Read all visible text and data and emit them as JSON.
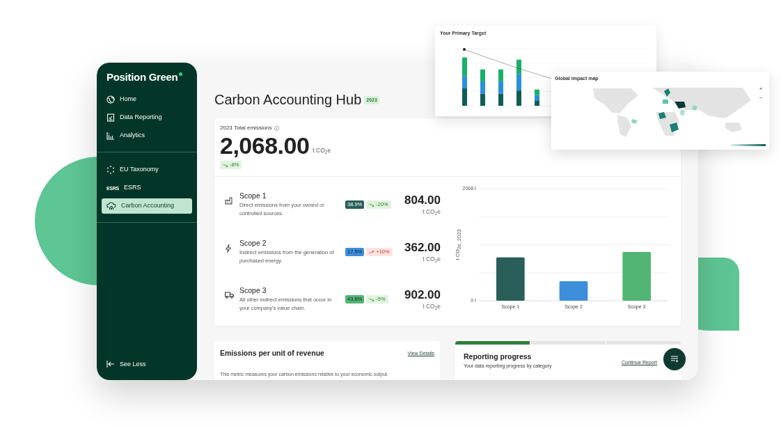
{
  "sidebar": {
    "logo": "Position Green",
    "groups": [
      {
        "items": [
          {
            "label": "Home",
            "kind": "icon",
            "selected": false
          },
          {
            "label": "Data Reporting",
            "kind": "icon",
            "selected": false
          },
          {
            "label": "Analytics",
            "kind": "icon",
            "selected": false
          }
        ]
      },
      {
        "items": [
          {
            "label": "EU Taxonomy",
            "kind": "icon",
            "selected": false
          },
          {
            "label": "ESRS",
            "kind": "text-icon",
            "icon_text": "ESRS",
            "selected": false
          },
          {
            "label": "Carbon Accounting",
            "kind": "icon",
            "selected": true
          }
        ]
      }
    ],
    "footer_link": "See Less"
  },
  "header": {
    "title": "Carbon Accounting Hub",
    "year_badge": "2023"
  },
  "total": {
    "label": "2023 Total emissions",
    "value": "2,068.00",
    "unit": "t CO$_{2}$e",
    "change": {
      "text": "-8%",
      "rising": false
    }
  },
  "scopes": [
    {
      "name": "Scope 1",
      "description": "Direct emissions from your owned or controlled sources.",
      "share": "38.9%",
      "color": "#2a5e58",
      "change": {
        "text": "-20%",
        "rising": false
      },
      "value": "804.00",
      "unit": "t CO$_{2}$e"
    },
    {
      "name": "Scope 2",
      "description": "Indirect emissions from the generation of purchased energy.",
      "share": "17.5%",
      "color": "#3d8fdc",
      "change": {
        "text": "+10%",
        "rising": true
      },
      "value": "362.00",
      "unit": "t CO$_{2}$e"
    },
    {
      "name": "Scope 3",
      "description": "All other indirect emissions that occur in your company's value chain.",
      "share": "43.6%",
      "color": "#52b574",
      "change": {
        "text": "-5%",
        "rising": false
      },
      "value": "902.00",
      "unit": "t CO$_{2}$e"
    }
  ],
  "chart_data": {
    "type": "bar",
    "ylabel": "t CO$_{2}$e, 2023",
    "categories": [
      "Scope 1",
      "Scope 2",
      "Scope 3"
    ],
    "series": [
      {
        "values": [
          800,
          360,
          900
        ]
      }
    ],
    "ylim": [
      0,
      2068
    ],
    "yticks": [
      {
        "value": 0,
        "label": "0 t"
      },
      {
        "value": 2068,
        "label": "2068 t"
      }
    ]
  },
  "cards": [
    {
      "title": "Emissions per unit of revenue",
      "link": "View Details",
      "description": "This metric measures your carbon emissions relative to your economic output."
    },
    {
      "title": "Reporting progress",
      "subtitle": "Your data reporting progress by category",
      "link": "Continue Report",
      "tabs": [
        {
          "selected": true
        },
        {
          "selected": false
        },
        {
          "selected": false
        }
      ]
    }
  ],
  "floating_panels": {
    "target": {
      "title": "Your Primary Target"
    },
    "map": {
      "title": "Global impact map",
      "zoom_in": "+",
      "zoom_out": "−"
    }
  }
}
